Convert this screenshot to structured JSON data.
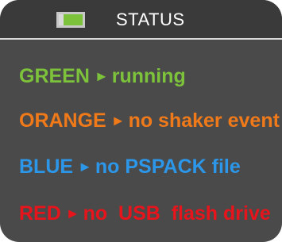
{
  "header": {
    "title": "STATUS",
    "indicator_color": "#7dc23b"
  },
  "legend": [
    {
      "color_name": "GREEN",
      "meaning": "running",
      "color": "#7dc23b"
    },
    {
      "color_name": "ORANGE",
      "meaning": "no shaker event",
      "color": "#f07a1a"
    },
    {
      "color_name": "BLUE",
      "meaning": "no PSPACK file",
      "color": "#2c96e8"
    },
    {
      "color_name": "RED",
      "meaning": "no  USB  flash drive",
      "color": "#e8141c"
    }
  ],
  "arrow_glyph": "►"
}
